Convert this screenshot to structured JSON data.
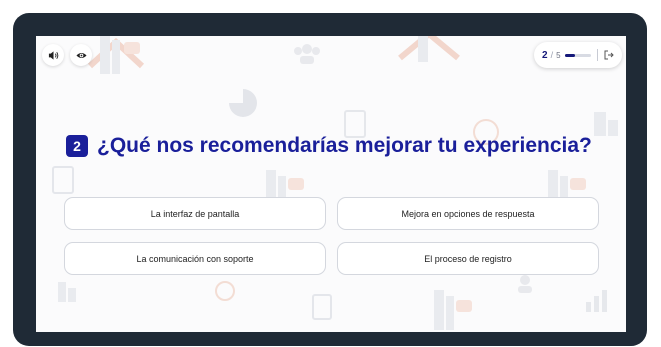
{
  "toolbar": {
    "audio_icon": "speaker-icon",
    "visibility_icon": "eye-icon"
  },
  "progress": {
    "current": "2",
    "separator": "/",
    "total": "5",
    "fraction": 0.4,
    "exit_icon": "exit-icon"
  },
  "question": {
    "number": "2",
    "text": "¿Qué nos recomendarías mejorar tu experiencia?"
  },
  "options": [
    {
      "label": "La interfaz de pantalla"
    },
    {
      "label": "Mejora en opciones de respuesta"
    },
    {
      "label": "La comunicación con soporte"
    },
    {
      "label": "El proceso de registro"
    }
  ],
  "colors": {
    "frame": "#1f2a36",
    "accent": "#1a1f9a",
    "background": "#fbfbfc"
  }
}
